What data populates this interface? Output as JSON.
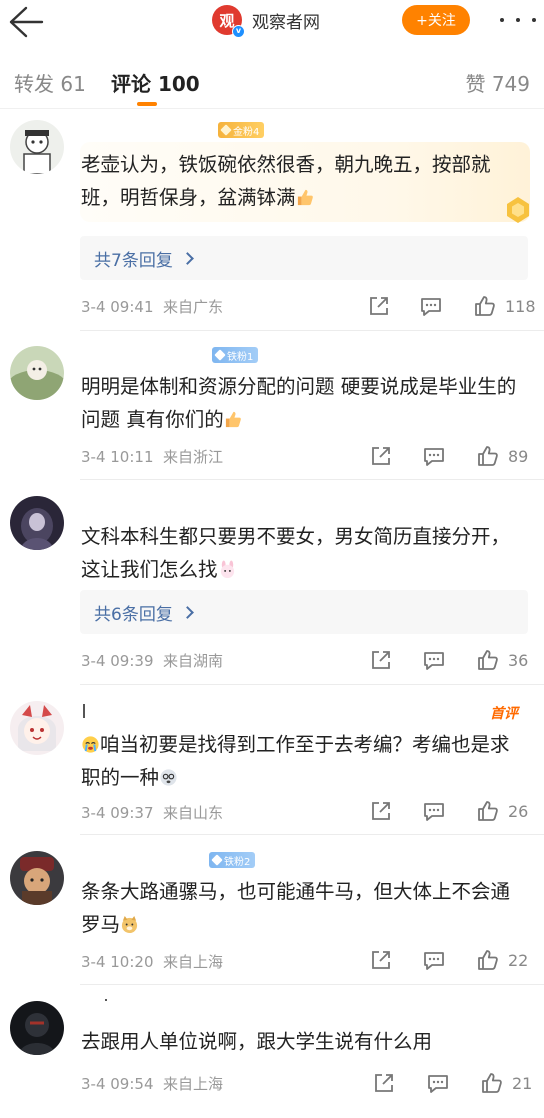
{
  "header": {
    "brand_initial": "观",
    "verified_mark": "v",
    "brand_name": "观察者网",
    "follow_label": "+关注"
  },
  "tabs": {
    "repost": "转发 61",
    "comments": "评论 100",
    "likes": "赞 749"
  },
  "comments": [
    {
      "badge": "金粉4",
      "badge_type": "gold",
      "text": "老壶认为，铁饭碗依然很香，朝九晚五，按部就班，明哲保身，盆满钵满",
      "emoji": "thumbs-up-emoji",
      "replies": "共7条回复",
      "date": "3-4 09:41",
      "location": "来自广东",
      "likes": "118"
    },
    {
      "badge": "铁粉1",
      "badge_type": "iron",
      "text": "明明是体制和资源分配的问题 硬要说成是毕业生的问题 真有你们的",
      "emoji": "thumbs-up-emoji",
      "date": "3-4 10:11",
      "location": "来自浙江",
      "likes": "89"
    },
    {
      "text": "文科本科生都只要男不要女，男女简历直接分开，这让我们怎么找",
      "emoji": "bunny-emoji",
      "replies": "共6条回复",
      "date": "3-4 09:39",
      "location": "来自湖南",
      "likes": "36"
    },
    {
      "tag": "首评",
      "text": "咱当初要是找得到工作至于去考编？考编也是求职的一种",
      "emoji_lead": "crying-face-emoji",
      "emoji": "dizzy-face-emoji",
      "date": "3-4 09:37",
      "location": "来自山东",
      "likes": "26"
    },
    {
      "badge": "铁粉2",
      "badge_type": "iron",
      "text": "条条大路通骡马，也可能通牛马，但大体上不会通罗马",
      "emoji": "doge-emoji",
      "date": "3-4 10:20",
      "location": "来自上海",
      "likes": "22"
    },
    {
      "text": "去跟用人单位说啊，跟大学生说有什么用",
      "date": "3-4 09:54",
      "location": "来自上海",
      "likes": "21"
    }
  ],
  "colors": {
    "accent": "#ff8200",
    "link": "#4a6fa5",
    "brand_red": "#e03a2f"
  }
}
